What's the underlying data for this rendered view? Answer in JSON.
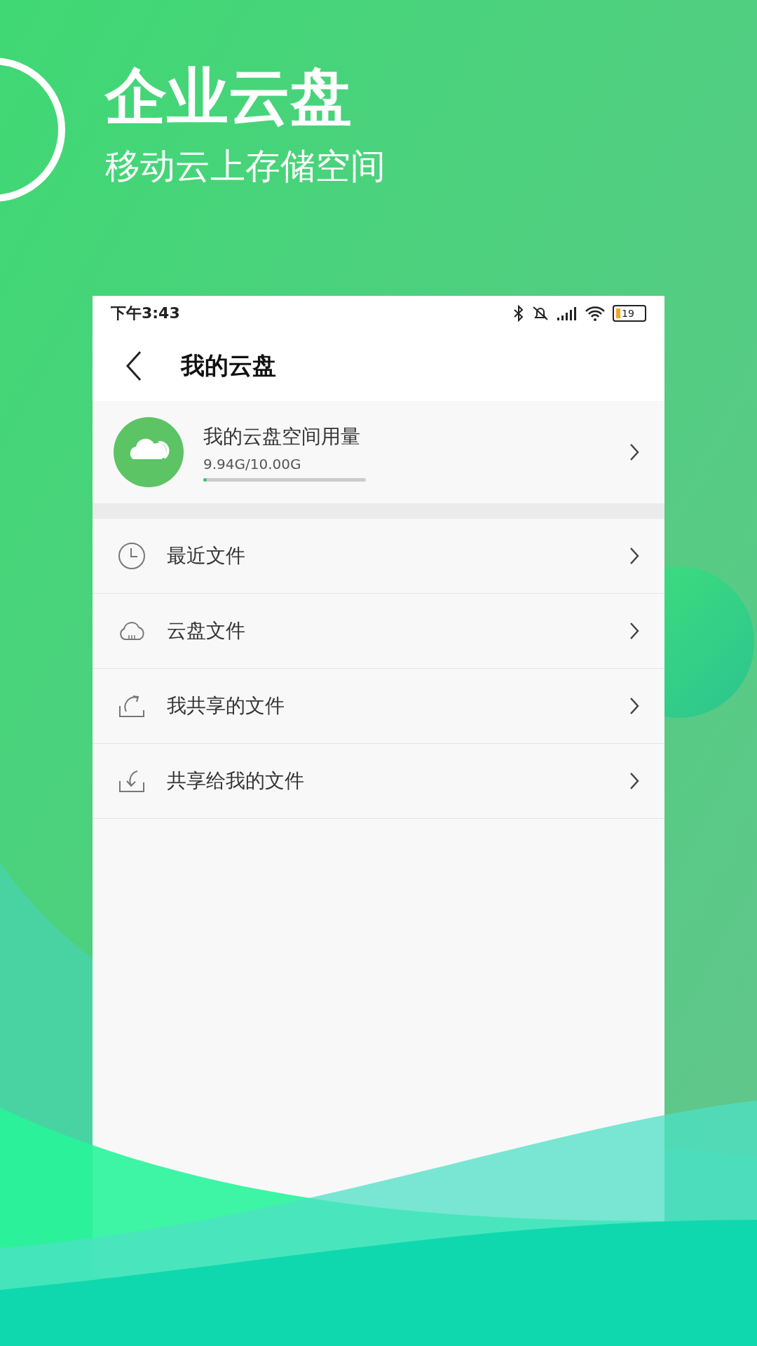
{
  "promo": {
    "title": "企业云盘",
    "subtitle": "移动云上存储空间"
  },
  "status_bar": {
    "time": "下午3:43",
    "battery": "19"
  },
  "nav": {
    "title": "我的云盘"
  },
  "usage": {
    "label": "我的云盘空间用量",
    "amount": "9.94G/10.00G",
    "level": 0.02
  },
  "menu": [
    {
      "kind": "clock",
      "label": "最近文件"
    },
    {
      "kind": "cloud",
      "label": "云盘文件"
    },
    {
      "kind": "share-out",
      "label": "我共享的文件"
    },
    {
      "kind": "share-in",
      "label": "共享给我的文件"
    }
  ]
}
